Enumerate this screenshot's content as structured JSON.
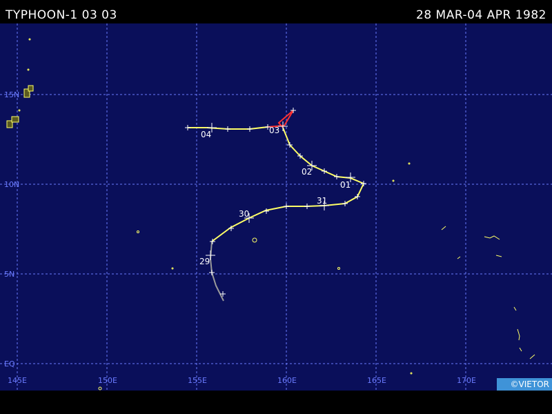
{
  "header": {
    "storm_name": "TYPHOON-1 03 03",
    "date_range": "28 MAR-04 APR 1982"
  },
  "map": {
    "background_color": "#0a0f5a",
    "grid_color": "#6b7bff",
    "latitude_labels": [
      "15N",
      "10N",
      "5N",
      "EQ"
    ],
    "longitude_labels": [
      "145E",
      "150E",
      "155E",
      "160E",
      "165E",
      "170E"
    ]
  },
  "track": {
    "colors": {
      "depression": "#9a9a9a",
      "storm": "#ffff66",
      "typhoon": "#ff3030"
    },
    "day_labels": [
      "29",
      "30",
      "31",
      "01",
      "02",
      "03",
      "04"
    ]
  },
  "credit": "©VIETOR"
}
